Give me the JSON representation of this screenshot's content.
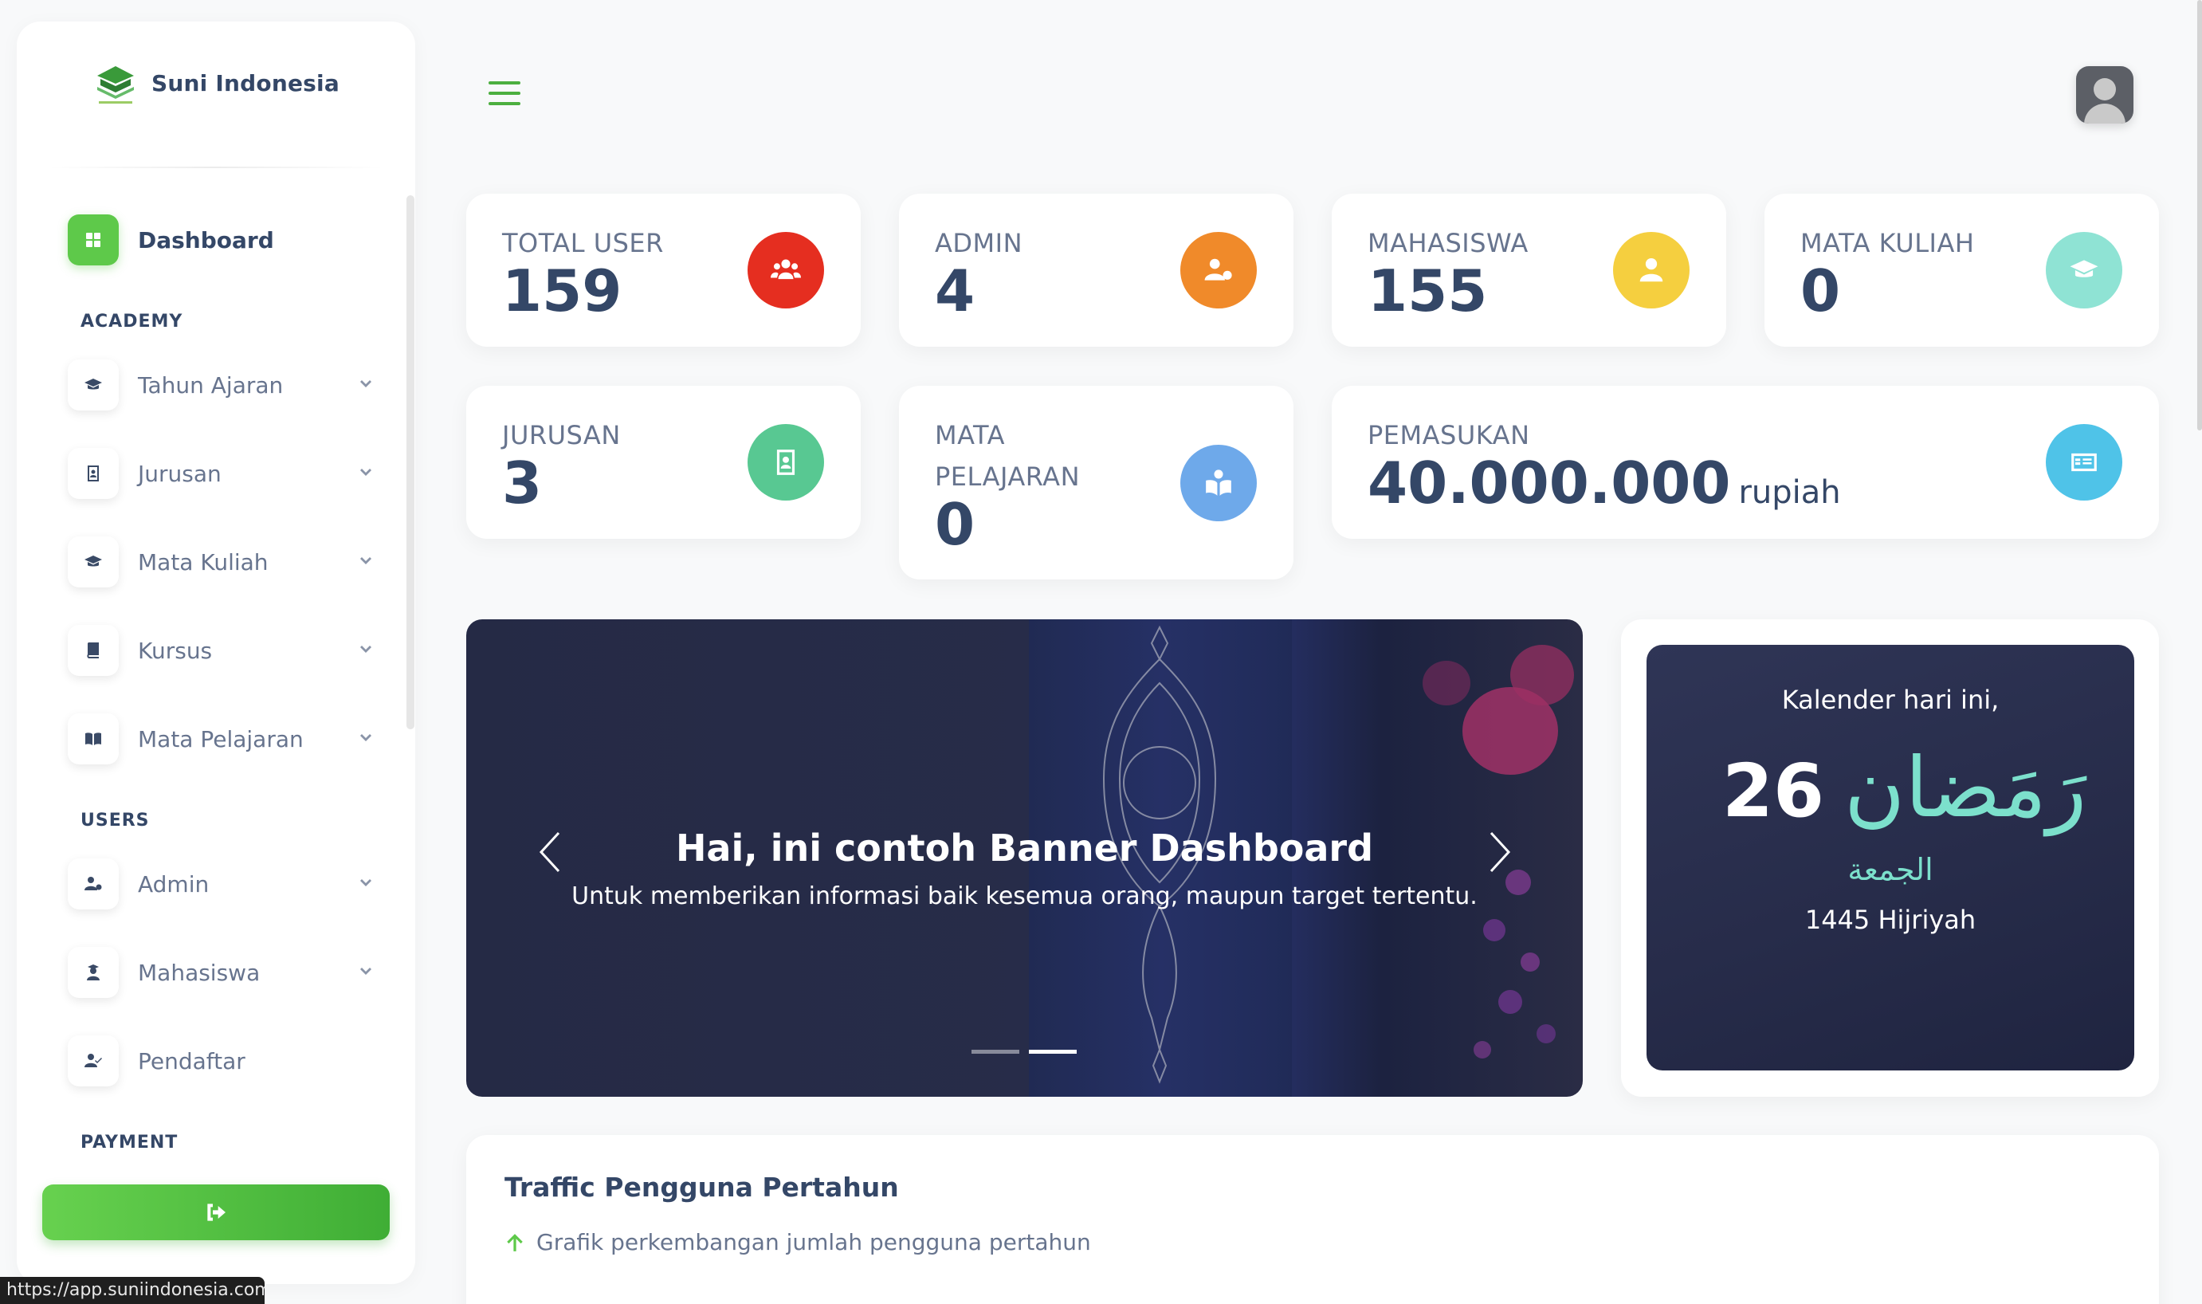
{
  "brand": {
    "name": "Suni Indonesia"
  },
  "sidebar": {
    "dashboard": {
      "label": "Dashboard",
      "icon": "grid-icon"
    },
    "sections": {
      "academy": "ACADEMY",
      "users": "USERS",
      "payment": "PAYMENT"
    },
    "academy_items": [
      {
        "label": "Tahun Ajaran",
        "icon": "graduation-cap-icon"
      },
      {
        "label": "Jurusan",
        "icon": "id-badge-icon"
      },
      {
        "label": "Mata Kuliah",
        "icon": "graduation-cap-icon"
      },
      {
        "label": "Kursus",
        "icon": "book-icon"
      },
      {
        "label": "Mata Pelajaran",
        "icon": "open-book-icon"
      }
    ],
    "user_items": [
      {
        "label": "Admin",
        "icon": "user-cog-icon"
      },
      {
        "label": "Mahasiswa",
        "icon": "student-icon"
      },
      {
        "label": "Pendaftar",
        "icon": "user-check-icon"
      }
    ],
    "logout_icon": "sign-out-icon"
  },
  "stats": {
    "total_user": {
      "title": "TOTAL USER",
      "value": "159",
      "color": "#e52e20",
      "icon": "users-icon"
    },
    "admin": {
      "title": "ADMIN",
      "value": "4",
      "color": "#f08a2a",
      "icon": "user-cog-icon"
    },
    "mahasiswa": {
      "title": "MAHASISWA",
      "value": "155",
      "color": "#f5cf3f",
      "icon": "user-icon"
    },
    "mata_kuliah": {
      "title": "MATA KULIAH",
      "value": "0",
      "color": "#8fe3d4",
      "icon": "graduation-cap-icon"
    },
    "jurusan": {
      "title": "JURUSAN",
      "value": "3",
      "color": "#58c892",
      "icon": "id-badge-icon"
    },
    "mata_pelajaran": {
      "title_line1": "MATA",
      "title_line2": "PELAJARAN",
      "value": "0",
      "color": "#6ea9ea",
      "icon": "book-reader-icon"
    },
    "pemasukan": {
      "title": "PEMASUKAN",
      "value": "40.000.000",
      "unit": "rupiah",
      "color": "#4fc3e8",
      "icon": "money-check-icon"
    }
  },
  "banner": {
    "title": "Hai, ini contoh Banner Dashboard",
    "subtitle": "Untuk memberikan informasi baik kesemua orang, maupun target tertentu.",
    "active_slide": 2,
    "slide_count": 2
  },
  "calendar": {
    "heading": "Kalender hari ini,",
    "day": "26",
    "month": "رَمَضان",
    "weekday": "الجمعة",
    "year": "1445 Hijriyah"
  },
  "traffic": {
    "title": "Traffic Pengguna Pertahun",
    "subtitle": "Grafik perkembangan jumlah pengguna pertahun"
  },
  "status_url": "https://app.suniindonesia.com"
}
